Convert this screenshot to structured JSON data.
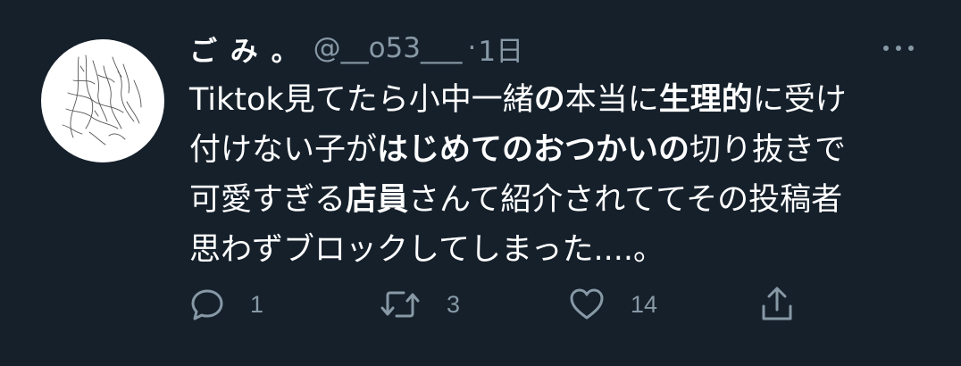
{
  "tweet": {
    "display_name": "ご み 。",
    "handle": "@__o53___",
    "separator": "·",
    "time": "1日",
    "lines": [
      [
        {
          "text": "Tiktok見てたら小中一緒",
          "bold": false
        },
        {
          "text": "の",
          "bold": true
        },
        {
          "text": "本当に",
          "bold": false
        },
        {
          "text": "生理的",
          "bold": true
        },
        {
          "text": "に受け",
          "bold": false
        }
      ],
      [
        {
          "text": "付けない子が",
          "bold": false
        },
        {
          "text": "はじめてのおつかいの",
          "bold": true
        },
        {
          "text": "切り抜きで",
          "bold": false
        }
      ],
      [
        {
          "text": "可愛すぎる",
          "bold": false
        },
        {
          "text": "店員",
          "bold": true
        },
        {
          "text": "さんて紹介されててその投稿者",
          "bold": false
        }
      ],
      [
        {
          "text": "思わずブロックしてしまった....。",
          "bold": false
        }
      ]
    ],
    "actions": {
      "reply_count": "1",
      "retweet_count": "3",
      "like_count": "14"
    }
  },
  "icons": {
    "more": "more-dots-icon",
    "reply": "reply-bubble-icon",
    "retweet": "retweet-icon",
    "like": "heart-icon",
    "share": "share-icon"
  },
  "colors": {
    "background": "#15202b",
    "text": "#ffffff",
    "muted": "#8899a6"
  }
}
